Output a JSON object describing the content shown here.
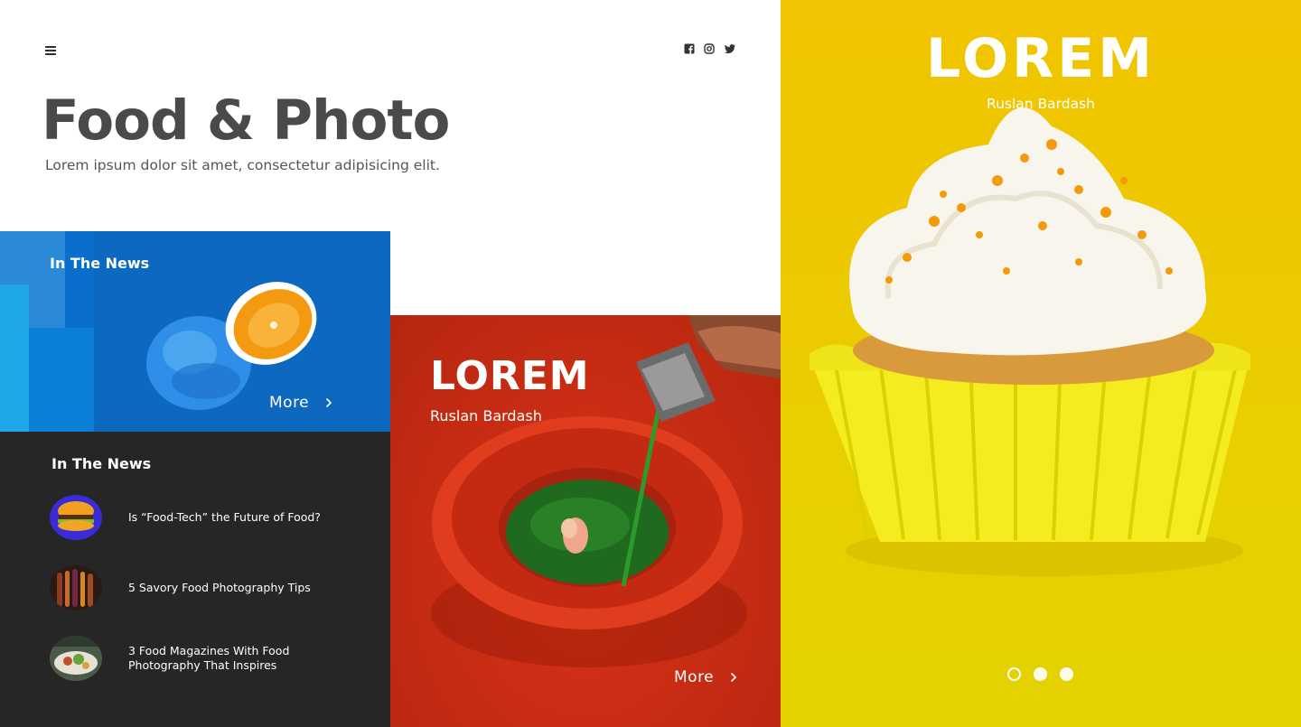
{
  "header": {
    "title": "Food & Photo",
    "subtitle": "Lorem ipsum dolor sit amet, consectetur adipisicing elit.",
    "menu_icon": "hamburger-menu-icon",
    "social_icons": [
      "facebook-icon",
      "instagram-icon",
      "twitter-icon"
    ]
  },
  "blue_card": {
    "label": "In The News",
    "more_label": "More",
    "color": "#0d68bf"
  },
  "news_panel": {
    "title": "In The News",
    "items": [
      {
        "title": "Is “Food-Tech” the Future of Food?"
      },
      {
        "title": "5 Savory Food Photography Tips"
      },
      {
        "title": "3 Food Magazines With Food Photography That Inspires"
      }
    ],
    "background": "#262626"
  },
  "red_card": {
    "title": "LOREM",
    "author": "Ruslan Bardash",
    "more_label": "More",
    "color": "#c92d14"
  },
  "hero": {
    "title": "LOREM",
    "author": "Ruslan Bardash",
    "slides": {
      "count": 3,
      "active": 1
    },
    "color": "#f0c400"
  }
}
